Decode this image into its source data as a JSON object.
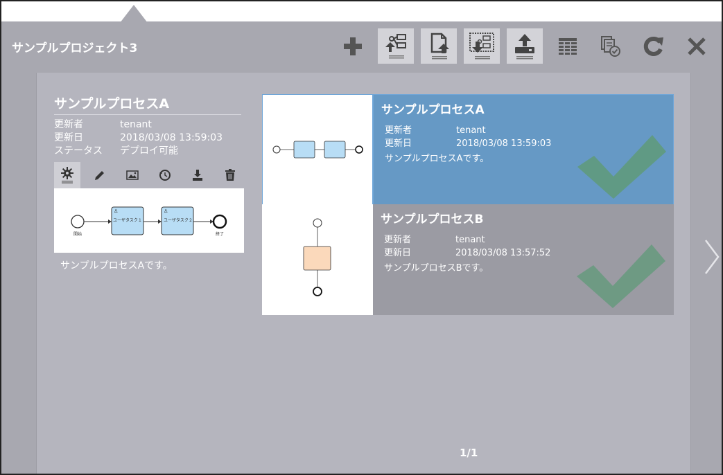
{
  "project": {
    "title": "サンプルプロジェクト3"
  },
  "toolbar": {
    "icons": [
      "plus-icon",
      "process-upload-icon",
      "document-upload-icon",
      "process-download-icon",
      "deploy-upload-icon",
      "table-icon",
      "schedule-list-icon",
      "refresh-icon",
      "close-icon"
    ]
  },
  "detail": {
    "title": "サンプルプロセスA",
    "updater_label": "更新者",
    "updater": "tenant",
    "updated_label": "更新日",
    "updated": "2018/03/08 13:59:03",
    "status_label": "ステータス",
    "status": "デプロイ可能",
    "description": "サンプルプロセスAです。",
    "diagram": {
      "start_label": "開始",
      "task1": "ユーザタスク１",
      "task2": "ユーザタスク２",
      "end_label": "終了"
    }
  },
  "cards": [
    {
      "title": "サンプルプロセスA",
      "updater_label": "更新者",
      "updater": "tenant",
      "updated_label": "更新日",
      "updated": "2018/03/08 13:59:03",
      "description": "サンプルプロセスAです。",
      "selected": true
    },
    {
      "title": "サンプルプロセスB",
      "updater_label": "更新者",
      "updater": "tenant",
      "updated_label": "更新日",
      "updated": "2018/03/08 13:57:52",
      "description": "サンプルプロセスBです。",
      "selected": false
    }
  ],
  "pager": {
    "text": "1/1"
  },
  "colors": {
    "selected": "#6699c5",
    "unselected": "#9b9ba3",
    "check": "#5f9a78",
    "panel": "#a8a8b0"
  }
}
